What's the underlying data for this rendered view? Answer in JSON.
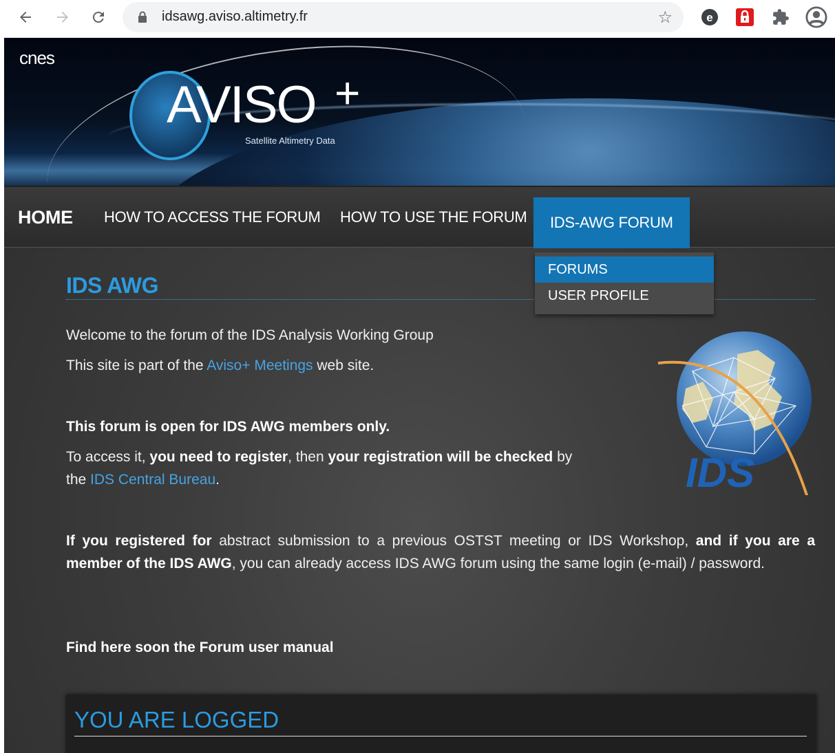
{
  "browser": {
    "url": "idsawg.aviso.altimetry.fr",
    "icons": [
      "back-arrow-icon",
      "forward-arrow-icon",
      "reload-icon",
      "lock-icon",
      "star-icon",
      "extension-e-icon",
      "extension-lock-icon",
      "puzzle-icon",
      "profile-icon"
    ]
  },
  "banner": {
    "cnes_label": "cnes",
    "logo_text": "AVISO",
    "logo_plus": "+",
    "logo_sub": "Satellite Altimetry Data"
  },
  "menu": {
    "home": "HOME",
    "access": "HOW TO ACCESS THE FORUM",
    "use": "HOW TO USE THE FORUM",
    "forum": "IDS-AWG FORUM"
  },
  "dropdown": {
    "forums": "FORUMS",
    "profile": "USER PROFILE"
  },
  "content": {
    "title": "IDS AWG",
    "welcome": "Welcome to the forum of the IDS Analysis Working Group",
    "part_pre": "This site is part of the ",
    "part_link": "Aviso+ Meetings",
    "part_post": " web site.",
    "open_notice": "This forum is open for IDS AWG members only.",
    "access_1": "To access it, ",
    "access_2": "you need to register",
    "access_3": ", then ",
    "access_4": "your registration will be checked",
    "access_5": " by",
    "access_6": "the ",
    "access_link": "IDS Central Bureau",
    "access_7": ".",
    "reg_1": "If you registered for",
    "reg_2": " abstract submission to a previous OSTST meeting or IDS Workshop, ",
    "reg_3": "and if you are a member of the IDS AWG",
    "reg_4": ", you can already access IDS AWG forum using the same login (e-mail) / password.",
    "manual": "Find here soon the Forum user manual",
    "ids_logo_text": "IDS"
  },
  "logged_box": {
    "title": "YOU ARE LOGGED"
  },
  "colors": {
    "accent": "#2c9be0",
    "menu_active": "#1375b4",
    "link": "#47a3e3",
    "ids_orange": "#e8a14a"
  }
}
